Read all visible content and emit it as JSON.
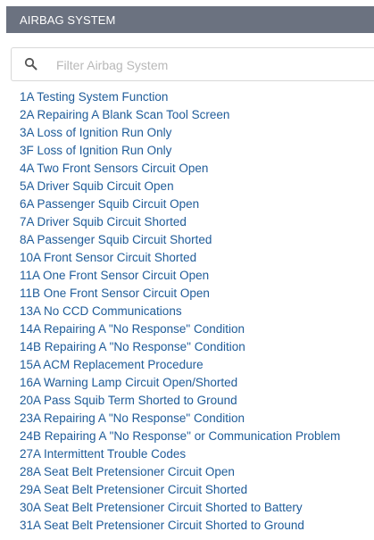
{
  "header": {
    "title": "AIRBAG SYSTEM"
  },
  "search": {
    "placeholder": "Filter Airbag System",
    "value": ""
  },
  "colors": {
    "header_bg": "#6b7280",
    "link": "#1f5c99",
    "placeholder": "#b8b8b8"
  },
  "items": [
    {
      "label": "1A Testing System Function"
    },
    {
      "label": "2A Repairing A Blank Scan Tool Screen"
    },
    {
      "label": "3A Loss of Ignition Run Only"
    },
    {
      "label": "3F Loss of Ignition Run Only"
    },
    {
      "label": "4A Two Front Sensors Circuit Open"
    },
    {
      "label": "5A Driver Squib Circuit Open"
    },
    {
      "label": "6A Passenger Squib Circuit Open"
    },
    {
      "label": "7A Driver Squib Circuit Shorted"
    },
    {
      "label": "8A Passenger Squib Circuit Shorted"
    },
    {
      "label": "10A Front Sensor Circuit Shorted"
    },
    {
      "label": "11A One Front Sensor Circuit Open"
    },
    {
      "label": "11B One Front Sensor Circuit Open"
    },
    {
      "label": "13A No CCD Communications"
    },
    {
      "label": "14A Repairing A \"No Response\" Condition"
    },
    {
      "label": "14B Repairing A \"No Response\" Condition"
    },
    {
      "label": "15A ACM Replacement Procedure"
    },
    {
      "label": "16A Warning Lamp Circuit Open/Shorted"
    },
    {
      "label": "20A Pass Squib Term Shorted to Ground"
    },
    {
      "label": "23A Repairing A \"No Response\" Condition"
    },
    {
      "label": "24B Repairing A \"No Response\" or Communication Problem"
    },
    {
      "label": "27A Intermittent Trouble Codes"
    },
    {
      "label": "28A Seat Belt Pretensioner Circuit Open"
    },
    {
      "label": "29A Seat Belt Pretensioner Circuit Shorted"
    },
    {
      "label": "30A Seat Belt Pretensioner Circuit Shorted to Battery"
    },
    {
      "label": "31A Seat Belt Pretensioner Circuit Shorted to Ground"
    }
  ]
}
